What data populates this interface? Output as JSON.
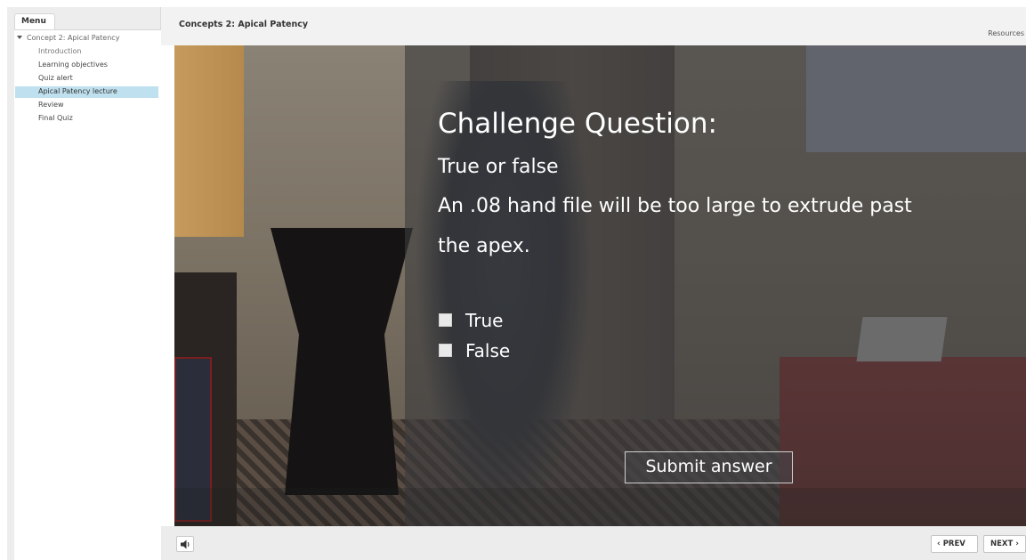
{
  "menu": {
    "tab_label": "Menu",
    "parent_label": "Concept 2: Apical Patency",
    "items": [
      {
        "label": "Introduction"
      },
      {
        "label": "Learning objectives"
      },
      {
        "label": "Quiz alert"
      },
      {
        "label": "Apical Patency lecture"
      },
      {
        "label": "Review"
      },
      {
        "label": "Final Quiz"
      }
    ],
    "active_index": 3
  },
  "header": {
    "title": "Concepts 2: Apical Patency",
    "resources_label": "Resources"
  },
  "question": {
    "title": "Challenge Question:",
    "subtitle": "True or false",
    "text_line1": "An .08 hand file will be too large to extrude past",
    "text_line2": "the apex.",
    "options": [
      {
        "label": "True",
        "checked": false
      },
      {
        "label": "False",
        "checked": false
      }
    ],
    "submit_label": "Submit answer"
  },
  "footer": {
    "volume_icon": "speaker-icon",
    "prev_label": "PREV",
    "next_label": "NEXT"
  },
  "colors": {
    "active_menu_bg": "#bfe0ee",
    "overlay": "rgba(60,60,62,0.62)",
    "sidebar_bg": "#ededed"
  }
}
